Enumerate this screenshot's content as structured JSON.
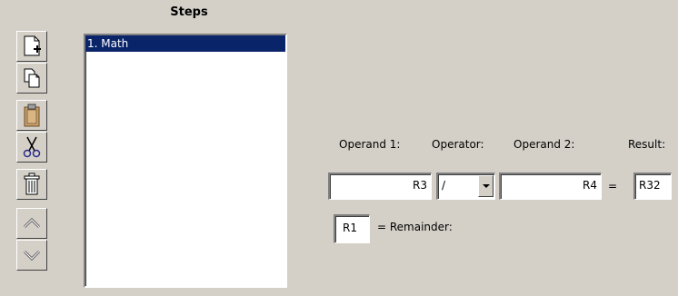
{
  "steps": {
    "title": "Steps",
    "items": [
      {
        "label": "1. Math",
        "selected": true
      }
    ]
  },
  "toolbar": {
    "buttons": [
      {
        "name": "new-step-button",
        "icon": "new-document-icon"
      },
      {
        "name": "copy-step-button",
        "icon": "copy-icon"
      },
      {
        "name": "paste-step-button",
        "icon": "clipboard-icon"
      },
      {
        "name": "cut-step-button",
        "icon": "scissors-icon"
      },
      {
        "name": "delete-step-button",
        "icon": "trash-icon"
      },
      {
        "name": "move-up-button",
        "icon": "chevron-up-icon"
      },
      {
        "name": "move-down-button",
        "icon": "chevron-down-icon"
      }
    ]
  },
  "math": {
    "operand1_label": "Operand 1:",
    "operator_label": "Operator:",
    "operand2_label": "Operand 2:",
    "result_label": "Result:",
    "operand1_value": "R3",
    "operator_value": "/",
    "operand2_value": "R4",
    "equals": "=",
    "result_value": "R32",
    "remainder_value": "R1",
    "remainder_label": "= Remainder:"
  },
  "colors": {
    "background": "#d4d0c8",
    "selection": "#0a246a"
  }
}
